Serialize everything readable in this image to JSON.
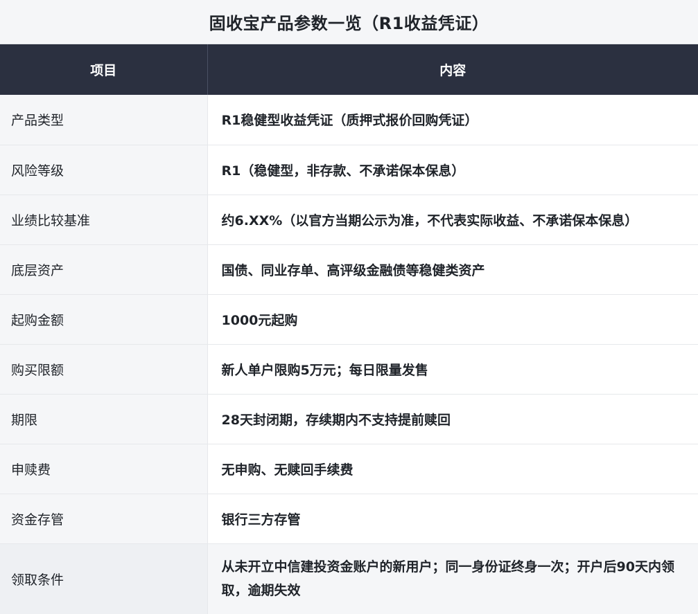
{
  "title": "固收宝产品参数一览（R1收益凭证）",
  "header": {
    "col1": "项目",
    "col2": "内容"
  },
  "rows": [
    {
      "label": "产品类型",
      "value": "R1稳健型收益凭证（质押式报价回购凭证）"
    },
    {
      "label": "风险等级",
      "value": "R1（稳健型，非存款、不承诺保本保息）"
    },
    {
      "label": "业绩比较基准",
      "value": "约6.XX%（以官方当期公示为准，不代表实际收益、不承诺保本保息）"
    },
    {
      "label": "底层资产",
      "value": "国债、同业存单、高评级金融债等稳健类资产"
    },
    {
      "label": "起购金额",
      "value": "1000元起购"
    },
    {
      "label": "购买限额",
      "value": "新人单户限购5万元；每日限量发售"
    },
    {
      "label": "期限",
      "value": "28天封闭期，存续期内不支持提前赎回"
    },
    {
      "label": "申赎费",
      "value": "无申购、无赎回手续费"
    },
    {
      "label": "资金存管",
      "value": "银行三方存管"
    },
    {
      "label": "领取条件",
      "value": "从未开立中信建投资金账户的新用户；同一身份证终身一次；开户后90天内领取，逾期失效"
    }
  ]
}
